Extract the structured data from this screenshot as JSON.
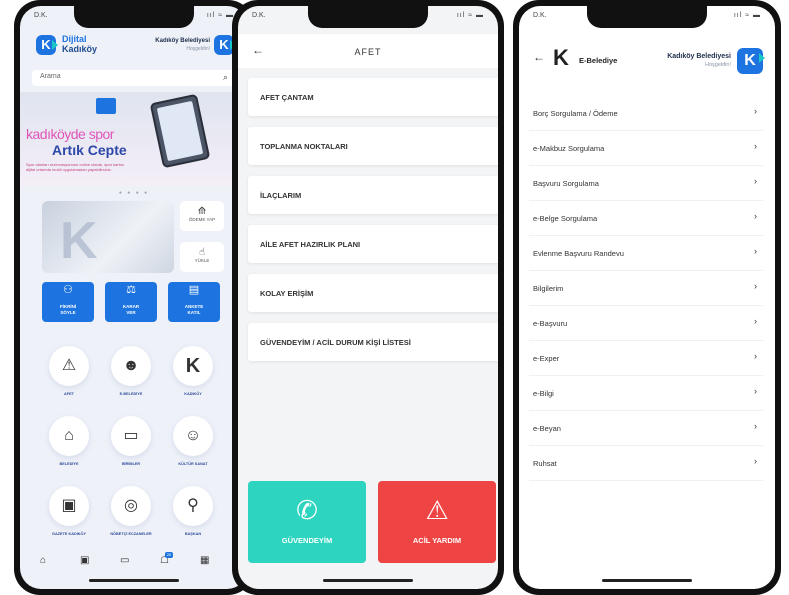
{
  "status": {
    "time_label": "D.K.",
    "indicators": "ııl ≈ ▬"
  },
  "home": {
    "brand_line1": "Dijital",
    "brand_line2": "Kadıköy",
    "muni_name": "Kadıköy Belediyesi",
    "muni_greeting": "Hoşgeldin!",
    "search_placeholder": "Arama",
    "banner_title1": "kadıköyde spor",
    "banner_title2": "Artık Cepte",
    "banner_small": "Spor alanları rezervasyonunu online olarak, spor kartını dijital ortamda mobil uygulamadan yapabilirsiniz.",
    "quick": [
      {
        "label": "ÖDEME YAP"
      },
      {
        "label": "YÜKLE"
      }
    ],
    "blue_buttons": [
      {
        "label1": "FİKRİNİ",
        "label2": "SÖYLE"
      },
      {
        "label1": "KARAR",
        "label2": "VER"
      },
      {
        "label1": "ANKETE",
        "label2": "KATIL"
      }
    ],
    "grid": [
      {
        "label": "AFET",
        "icon": "siren-icon"
      },
      {
        "label": "E-BELEDİYE",
        "icon": "people-icon"
      },
      {
        "label": "KADIKÖY",
        "icon": "k-logo-icon"
      },
      {
        "label": "BELEDİYE",
        "icon": "building-icon"
      },
      {
        "label": "BİRİMLER",
        "icon": "card-icon"
      },
      {
        "label": "KÜLTÜR SANAT",
        "icon": "theater-masks-icon"
      },
      {
        "label": "GAZETE KADIKÖY",
        "icon": "newspaper-icon"
      },
      {
        "label": "NÖBETÇİ ECZANELER",
        "icon": "location-pin-icon"
      },
      {
        "label": "BAŞKAN",
        "icon": "tap-icon"
      }
    ],
    "tab_badge": "20"
  },
  "afet": {
    "title": "AFET",
    "items": [
      "AFET ÇANTAM",
      "TOPLANMA NOKTALARI",
      "İLAÇLARIM",
      "AİLE AFET HAZIRLIK PLANI",
      "KOLAY ERİŞİM",
      "GÜVENDEYİM / ACİL DURUM KİŞİ LİSTESİ"
    ],
    "safe_button": "GÜVENDEYİM",
    "emergency_button": "ACİL YARDIM",
    "colors": {
      "safe": "#2dd4bf",
      "emergency": "#ef4444"
    }
  },
  "ebelediye": {
    "title": "E-Belediye",
    "muni_name": "Kadıköy Belediyesi",
    "muni_greeting": "Hoşgeldin!",
    "items": [
      "Borç Sorgulama / Ödeme",
      "e-Makbuz Sorgulama",
      "Başvuru Sorgulama",
      "e-Belge Sorgulama",
      "Evlenme Başvuru Randevu",
      "Bilgilerim",
      "e-Başvuru",
      "e-Exper",
      "e-Bilgi",
      "e-Beyan",
      "Ruhsat"
    ]
  },
  "colors": {
    "brand_blue": "#1d74e0",
    "brand_teal": "#19c6c6"
  }
}
